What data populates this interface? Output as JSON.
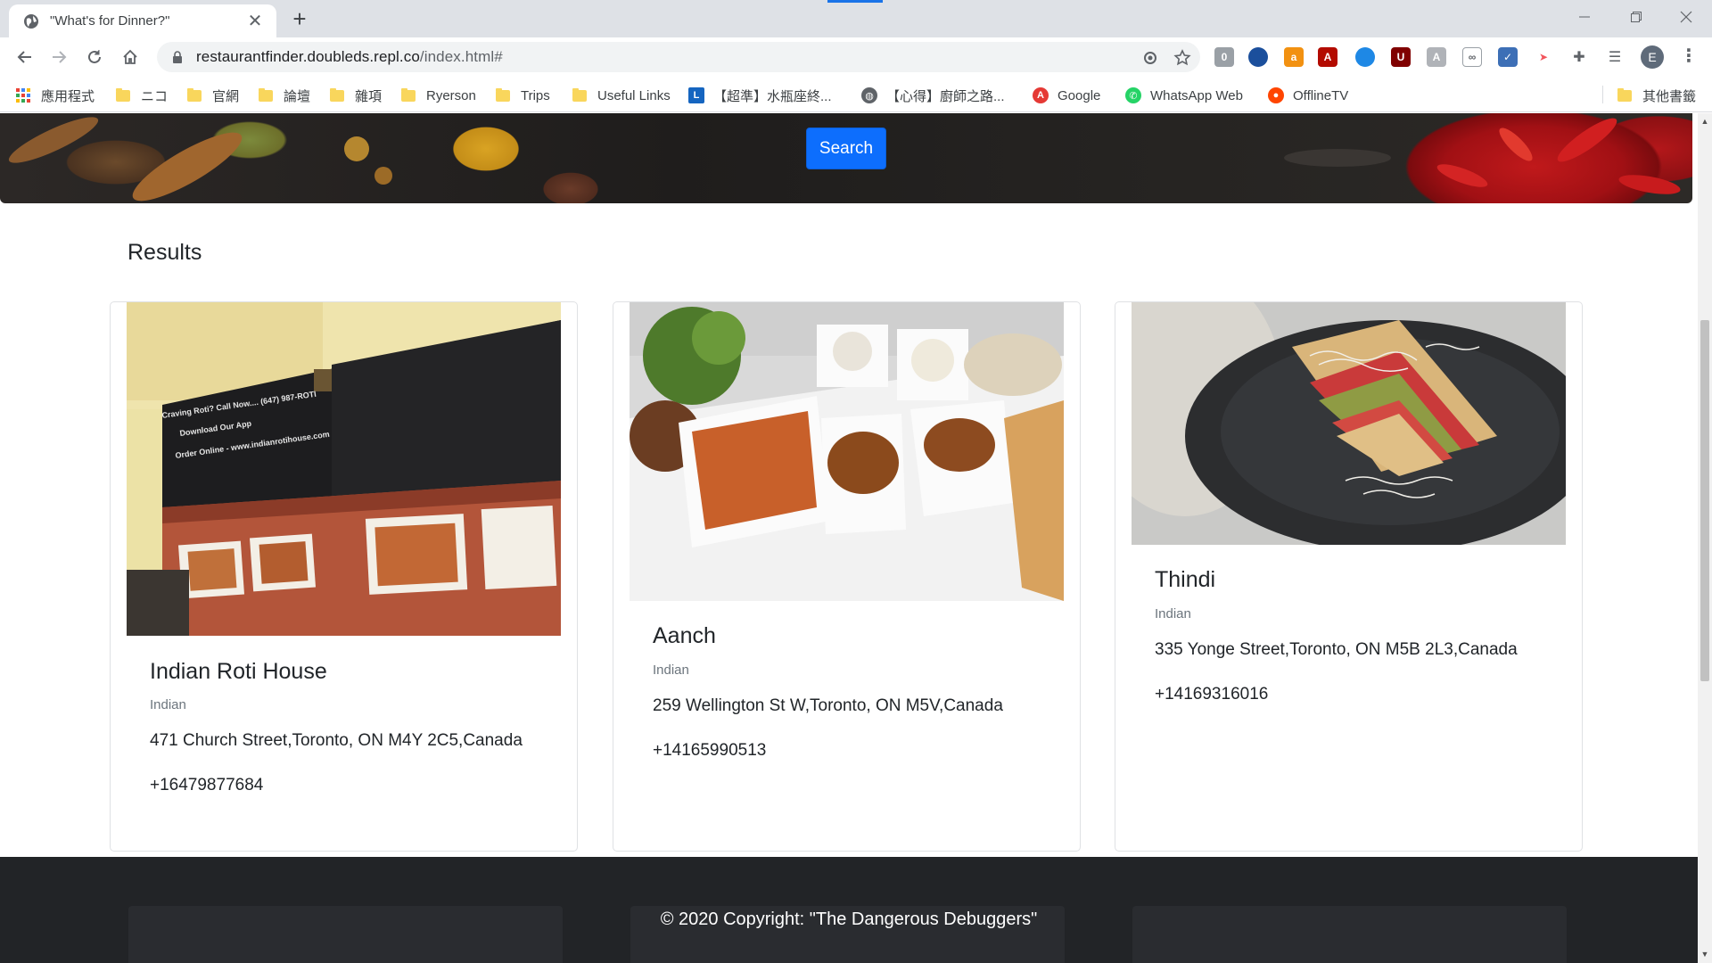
{
  "browser": {
    "tab_title": "\"What's for Dinner?\"",
    "tab_close": "✕",
    "new_tab": "+",
    "url_host": "restaurantfinder.doubleds.repl.co",
    "url_path": "/index.html#",
    "profile_initial": "E",
    "menu_glyph": "⋮",
    "bookmarks": [
      {
        "label": "應用程式",
        "icon": "apps-grid-icon"
      },
      {
        "label": "ニコ",
        "icon": "folder-icon"
      },
      {
        "label": "官網",
        "icon": "folder-icon"
      },
      {
        "label": "論壇",
        "icon": "folder-icon"
      },
      {
        "label": "雜項",
        "icon": "folder-icon"
      },
      {
        "label": "Ryerson",
        "icon": "folder-icon"
      },
      {
        "label": "Trips",
        "icon": "folder-icon"
      },
      {
        "label": "Useful Links",
        "icon": "folder-icon"
      },
      {
        "label": "【超準】水瓶座終...",
        "icon": "l-logo-icon"
      },
      {
        "label": "【心得】廚師之路...",
        "icon": "globe-icon"
      },
      {
        "label": "Google",
        "icon": "google-icon"
      },
      {
        "label": "WhatsApp Web",
        "icon": "whatsapp-icon"
      },
      {
        "label": "OfflineTV",
        "icon": "reddit-icon"
      },
      {
        "label": "其他書籤",
        "icon": "folder-icon"
      }
    ]
  },
  "hero": {
    "search_label": "Search"
  },
  "results": {
    "title": "Results",
    "cards": [
      {
        "name": "Indian Roti House",
        "cuisine": "Indian",
        "address": "471 Church Street,Toronto, ON M4Y 2C5,Canada",
        "phone": "+16479877684"
      },
      {
        "name": "Aanch",
        "cuisine": "Indian",
        "address": "259 Wellington St W,Toronto, ON M5V,Canada",
        "phone": "+14165990513"
      },
      {
        "name": "Thindi",
        "cuisine": "Indian",
        "address": "335 Yonge Street,Toronto, ON M5B 2L3,Canada",
        "phone": "+14169316016"
      }
    ]
  },
  "footer": {
    "copyright": "© 2020 Copyright: \"The Dangerous Debuggers\""
  },
  "colors": {
    "primary": "#0d6efd",
    "footer_bg": "#222427",
    "tab_strip": "#dee1e6"
  }
}
